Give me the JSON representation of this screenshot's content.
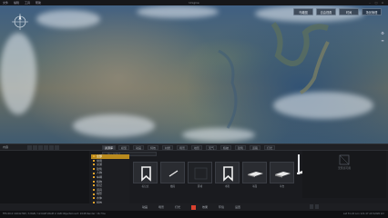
{
  "titlebar": {
    "menu": [
      "文件",
      "编辑",
      "工具",
      "帮助"
    ],
    "title": "Unigine"
  },
  "viewport_buttons": [
    "鸟瞰图",
    "自由视角",
    "时间",
    "场景管理"
  ],
  "toolbar": {
    "left_label": "内容",
    "tabs": [
      "资源库",
      "模型",
      "动画",
      "特效",
      "材质",
      "场景",
      "地形",
      "天气",
      "植被",
      "建筑",
      "道路",
      "灯光"
    ],
    "search_placeholder": "输入关键词"
  },
  "tree": {
    "items": [
      "全部",
      "常用",
      "交通",
      "建筑",
      "人物",
      "车辆",
      "植物",
      "标记",
      "道具",
      "地形",
      "水体",
      "特效",
      "其他"
    ],
    "selected": 0
  },
  "assets": [
    {
      "label": "标记点",
      "icon": "bookmark-icon"
    },
    {
      "label": "线段",
      "icon": "line-icon"
    },
    {
      "label": "区域",
      "icon": "area-icon"
    },
    {
      "label": "书签",
      "icon": "bookmark-icon"
    },
    {
      "label": "平面",
      "icon": "plane-icon"
    },
    {
      "label": "平台",
      "icon": "plane-icon"
    },
    {
      "label": "底座",
      "icon": "plane-icon"
    }
  ],
  "preview": {
    "caption": "无预览可用"
  },
  "bottom_tabs": [
    "动画",
    "场景",
    "灯光",
    "效果",
    "环境",
    "设置"
  ],
  "status": {
    "left": "FPS 60.0   1024x768 / 3.8GB / 12.6GB  VRAM 2.1GB  ObjectsCount: 2048  Render: 16.7ms",
    "right": "Lat 31.24  Lon 121.47  Alt 6,820 km"
  }
}
